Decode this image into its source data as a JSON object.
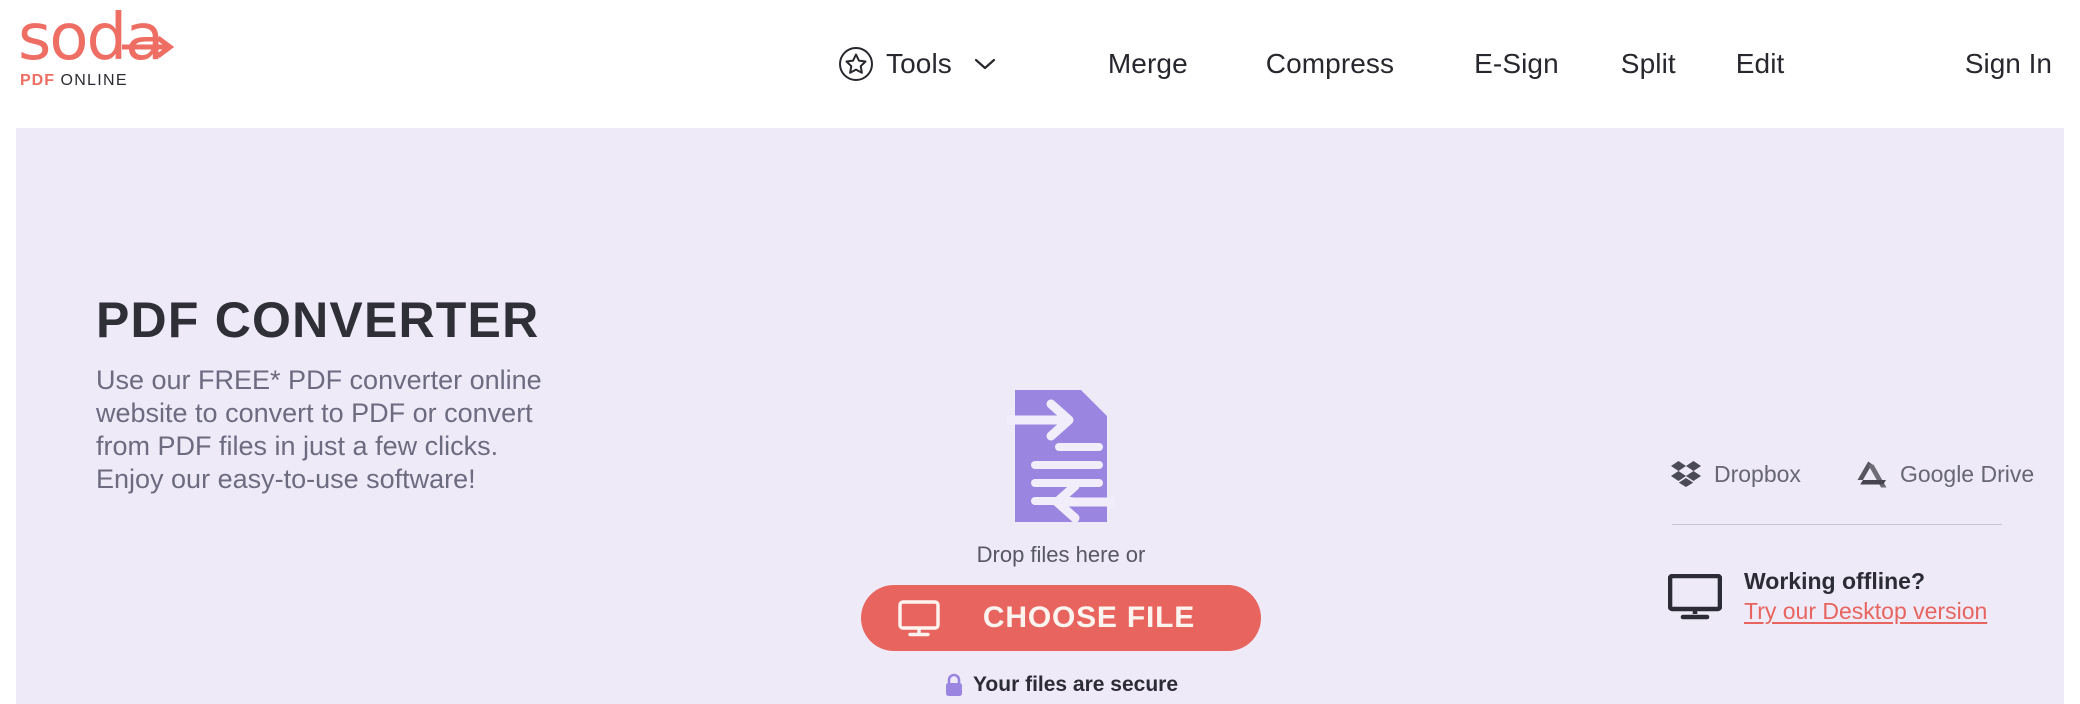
{
  "header": {
    "logo": {
      "word": "soda",
      "sub_pdf": "PDF",
      "sub_online": "ONLINE",
      "arrow_icon": "arrow-right-icon",
      "brand_color": "#ee6e64"
    },
    "nav": [
      {
        "label": "Tools",
        "icon": "star-circle-icon",
        "has_chevron": true
      },
      {
        "label": "Merge",
        "icon": null,
        "has_chevron": false
      },
      {
        "label": "Compress",
        "icon": null,
        "has_chevron": false
      },
      {
        "label": "E-Sign",
        "icon": null,
        "has_chevron": false
      },
      {
        "label": "Split",
        "icon": null,
        "has_chevron": false
      },
      {
        "label": "Edit",
        "icon": null,
        "has_chevron": false
      }
    ],
    "sign_in": "Sign In"
  },
  "hero": {
    "background_color": "#eeeaf8",
    "title": "PDF CONVERTER",
    "description": "Use our FREE* PDF converter online website to convert to PDF or convert from PDF files in just a few clicks. Enjoy our easy-to-use software!"
  },
  "drop": {
    "doc_icon": "pdf-convert-document-icon",
    "doc_icon_color": "#9a86e0",
    "drop_text": "Drop files here or",
    "choose_button": {
      "label": "CHOOSE FILE",
      "icon": "monitor-icon",
      "color": "#e8645e"
    },
    "secure": {
      "icon": "lock-icon",
      "text": "Your files are secure",
      "icon_color": "#9a86e0"
    }
  },
  "cloud": {
    "sources": [
      {
        "label": "Dropbox",
        "icon": "dropbox-icon"
      },
      {
        "label": "Google Drive",
        "icon": "google-drive-icon"
      }
    ]
  },
  "offline": {
    "icon": "desktop-monitor-icon",
    "question": "Working offline?",
    "link": "Try our Desktop version",
    "link_color": "#e8645e"
  }
}
